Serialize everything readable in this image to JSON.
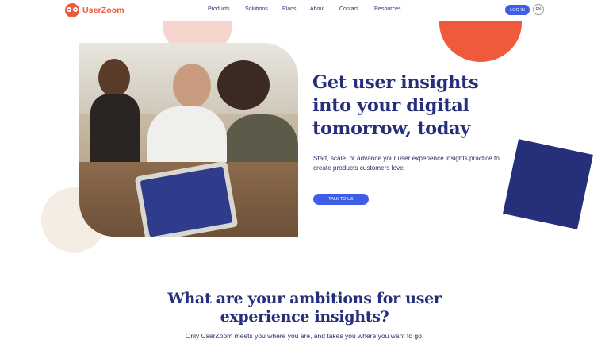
{
  "brand": {
    "name": "UserZoom",
    "accent": "#ef5a3c",
    "navy": "#26307a",
    "button_blue": "#3e5ee8"
  },
  "nav": {
    "items": [
      "Products",
      "Solutions",
      "Plans",
      "About",
      "Contact",
      "Resources"
    ],
    "login_label": "LOG IN",
    "language": "EN"
  },
  "hero": {
    "title_lines": [
      "Get user insights",
      "into your digital",
      "tomorrow, today"
    ],
    "subtitle": "Start, scale, or advance your user experience insights practice to create products customers love.",
    "cta_label": "TALK TO US",
    "image": "team-working-on-laptop-photo"
  },
  "section": {
    "title_lines": [
      "What are your ambitions for user",
      "experience insights?"
    ],
    "subtitle": "Only UserZoom meets you where you are, and takes you where you want to go."
  }
}
